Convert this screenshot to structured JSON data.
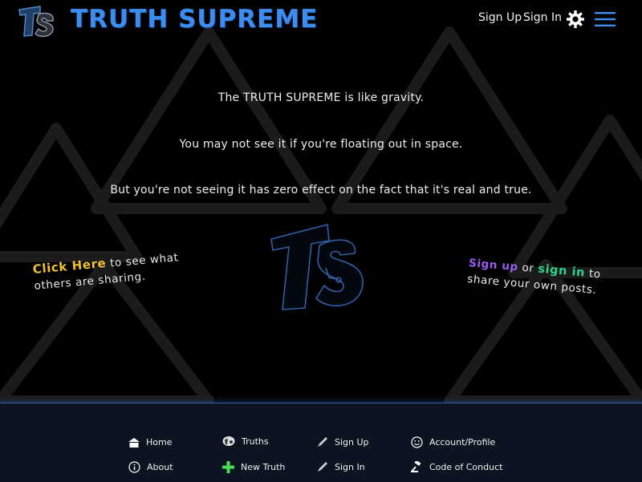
{
  "header": {
    "brand": "TRUTH SUPREME",
    "signup": "Sign Up",
    "signin": "Sign In",
    "logo_icon": "ts-logo-icon",
    "settings_icon": "gear-icon",
    "menu_icon": "hamburger-menu-icon"
  },
  "main": {
    "line1": "The TRUTH SUPREME is like gravity.",
    "line2": "You may not see it if you're floating out in space.",
    "line3": "But you're not seeing it has zero effect on the fact that it's real and true.",
    "left_cta": {
      "link": "Click Here",
      "text": " to see what others are sharing."
    },
    "right_cta": {
      "signup": "Sign up",
      "or": " or ",
      "signin": "sign in",
      "text": " to share your own posts."
    }
  },
  "footer": {
    "items": [
      {
        "label": "Home",
        "icon": "home-icon"
      },
      {
        "label": "Truths",
        "icon": "truths-icon"
      },
      {
        "label": "Sign Up",
        "icon": "pen-icon"
      },
      {
        "label": "Account/Profile",
        "icon": "smiley-icon"
      },
      {
        "label": "About",
        "icon": "info-icon"
      },
      {
        "label": "New Truth",
        "icon": "plus-icon"
      },
      {
        "label": "Sign In",
        "icon": "pen-icon"
      },
      {
        "label": "Code of Conduct",
        "icon": "gavel-icon"
      }
    ]
  },
  "colors": {
    "brand": "#3d8cf0",
    "click_here": "#f2c12e",
    "sign_up": "#9b5cf0",
    "sign_in": "#2fd18a",
    "footer_bg": "#0b1420"
  }
}
